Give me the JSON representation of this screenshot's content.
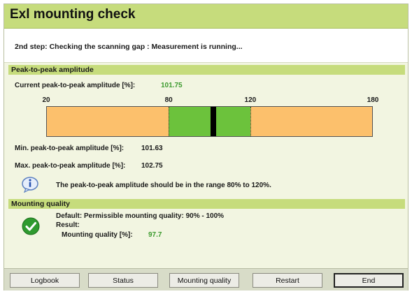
{
  "window": {
    "title": "Exl mounting check",
    "step_text": "2nd step: Checking the scanning gap : Measurement is running..."
  },
  "amplitude_section": {
    "header": "Peak-to-peak amplitude",
    "current_label": "Current peak-to-peak amplitude [%]:",
    "current_value": "101.75",
    "scale": {
      "min": 20,
      "max": 180,
      "range_low": 80,
      "range_high": 120,
      "current": 101.75
    },
    "tick_labels": [
      "20",
      "80",
      "120",
      "180"
    ],
    "min_label": "Min. peak-to-peak amplitude [%]:",
    "min_value": "101.63",
    "max_label": "Max. peak-to-peak amplitude [%]:",
    "max_value": "102.75",
    "info_text": "The peak-to-peak amplitude should be in the range 80% to 120%."
  },
  "mounting_section": {
    "header": "Mounting quality",
    "default_text": "Default: Permissible mounting quality: 90% - 100%",
    "result_label": "Result:",
    "quality_label": "Mounting quality [%]:",
    "quality_value": "97.7"
  },
  "buttons": {
    "logbook": "Logbook",
    "status": "Status",
    "mounting_quality": "Mounting quality",
    "restart": "Restart",
    "end": "End"
  },
  "colors": {
    "title_green": "#c6dc7c",
    "window_bg": "#f2f5e1",
    "bar_orange": "#fcc06c",
    "range_green": "#6cc23c",
    "value_green": "#3c9a2e"
  },
  "icons": {
    "info": "info-icon",
    "check": "check-circle-icon"
  }
}
